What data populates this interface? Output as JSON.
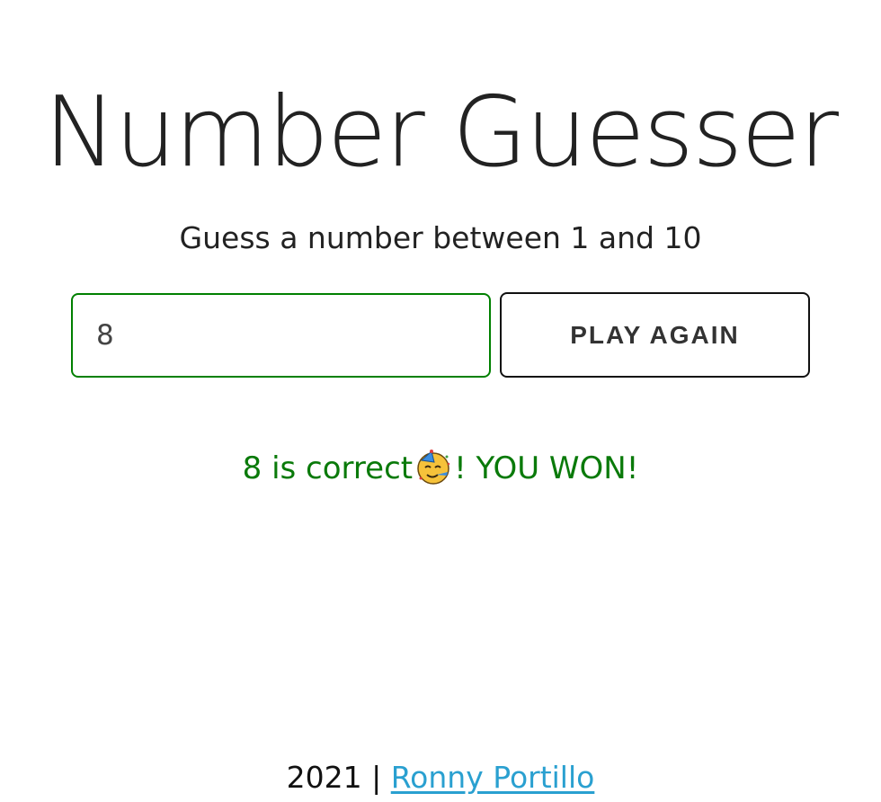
{
  "header": {
    "title": "Number Guesser"
  },
  "instructions": {
    "text": "Guess a number between 1 and 10"
  },
  "guess": {
    "value": "8",
    "border_color": "#008000"
  },
  "actions": {
    "play_again_label": "PLAY AGAIN"
  },
  "message": {
    "before_icon": "8 is correct",
    "icon": "partying-face-icon",
    "after_icon": "! YOU WON!",
    "color": "#0a7a0a"
  },
  "footer": {
    "year": "2021",
    "separator": " | ",
    "author_link": "Ronny Portillo",
    "link_color": "#2aa0d0"
  }
}
